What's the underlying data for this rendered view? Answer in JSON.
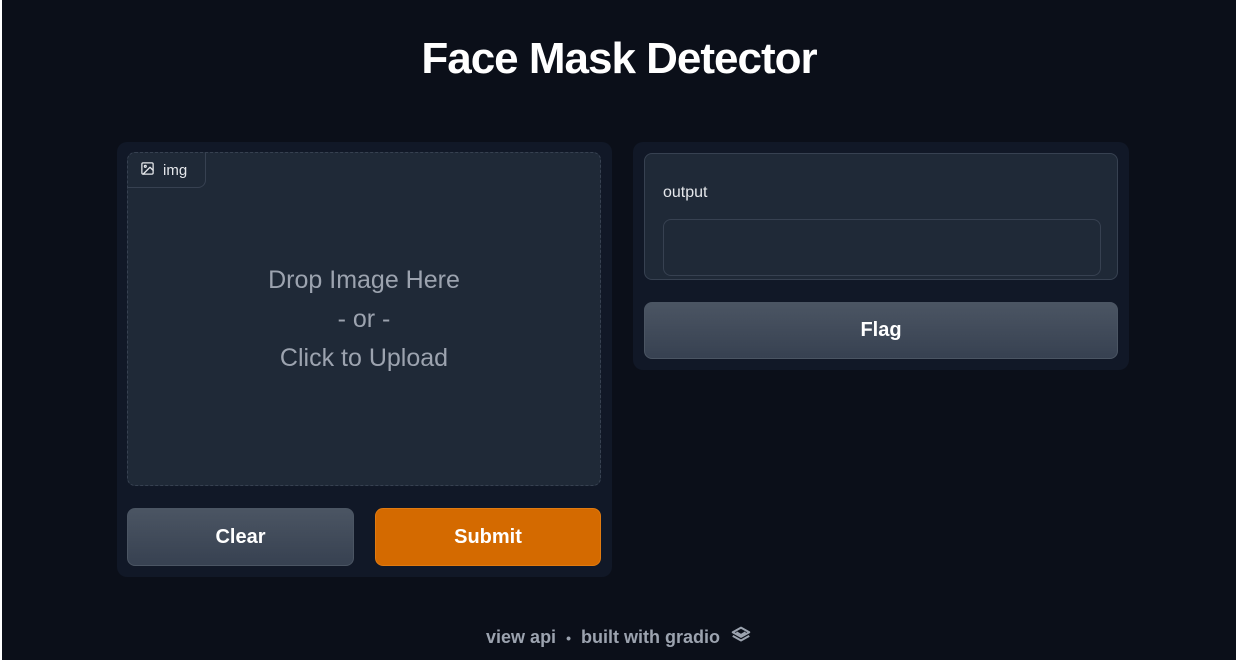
{
  "app": {
    "title": "Face Mask Detector"
  },
  "input": {
    "image_label": "img",
    "image_icon": "image-icon",
    "drop_line1": "Drop Image Here",
    "drop_line2": "- or -",
    "drop_line3": "Click to Upload"
  },
  "actions": {
    "clear_label": "Clear",
    "submit_label": "Submit",
    "flag_label": "Flag"
  },
  "output": {
    "label": "output",
    "value": ""
  },
  "footer": {
    "view_api": "view api",
    "separator": "•",
    "built_with": "built with gradio",
    "logo_icon": "gradio-logo-icon"
  },
  "colors": {
    "background": "#0b0f19",
    "panel": "#111827",
    "block": "#1f2937",
    "accent": "#d46a00"
  }
}
